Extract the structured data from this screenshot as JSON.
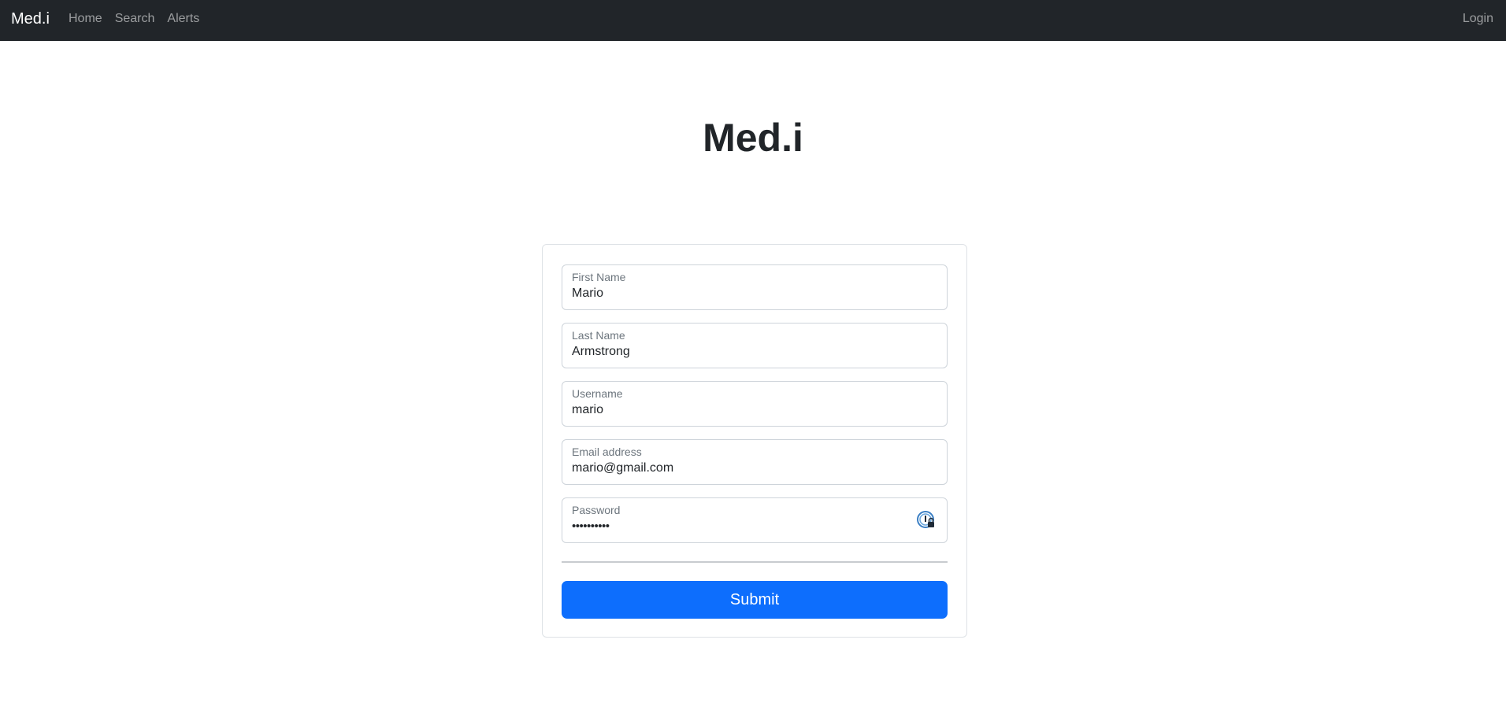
{
  "navbar": {
    "brand": "Med.i",
    "links": [
      "Home",
      "Search",
      "Alerts"
    ],
    "right_link": "Login"
  },
  "page": {
    "title": "Med.i"
  },
  "form": {
    "fields": [
      {
        "label": "First Name",
        "value": "Mario"
      },
      {
        "label": "Last Name",
        "value": "Armstrong"
      },
      {
        "label": "Username",
        "value": "mario"
      },
      {
        "label": "Email address",
        "value": "mario@gmail.com"
      },
      {
        "label": "Password",
        "value": "••••••••••"
      }
    ],
    "password_manager_icon": "password-manager-icon",
    "submit_label": "Submit"
  },
  "colors": {
    "navbar_bg": "#212529",
    "primary": "#0d6efd",
    "border": "#ced4da"
  }
}
